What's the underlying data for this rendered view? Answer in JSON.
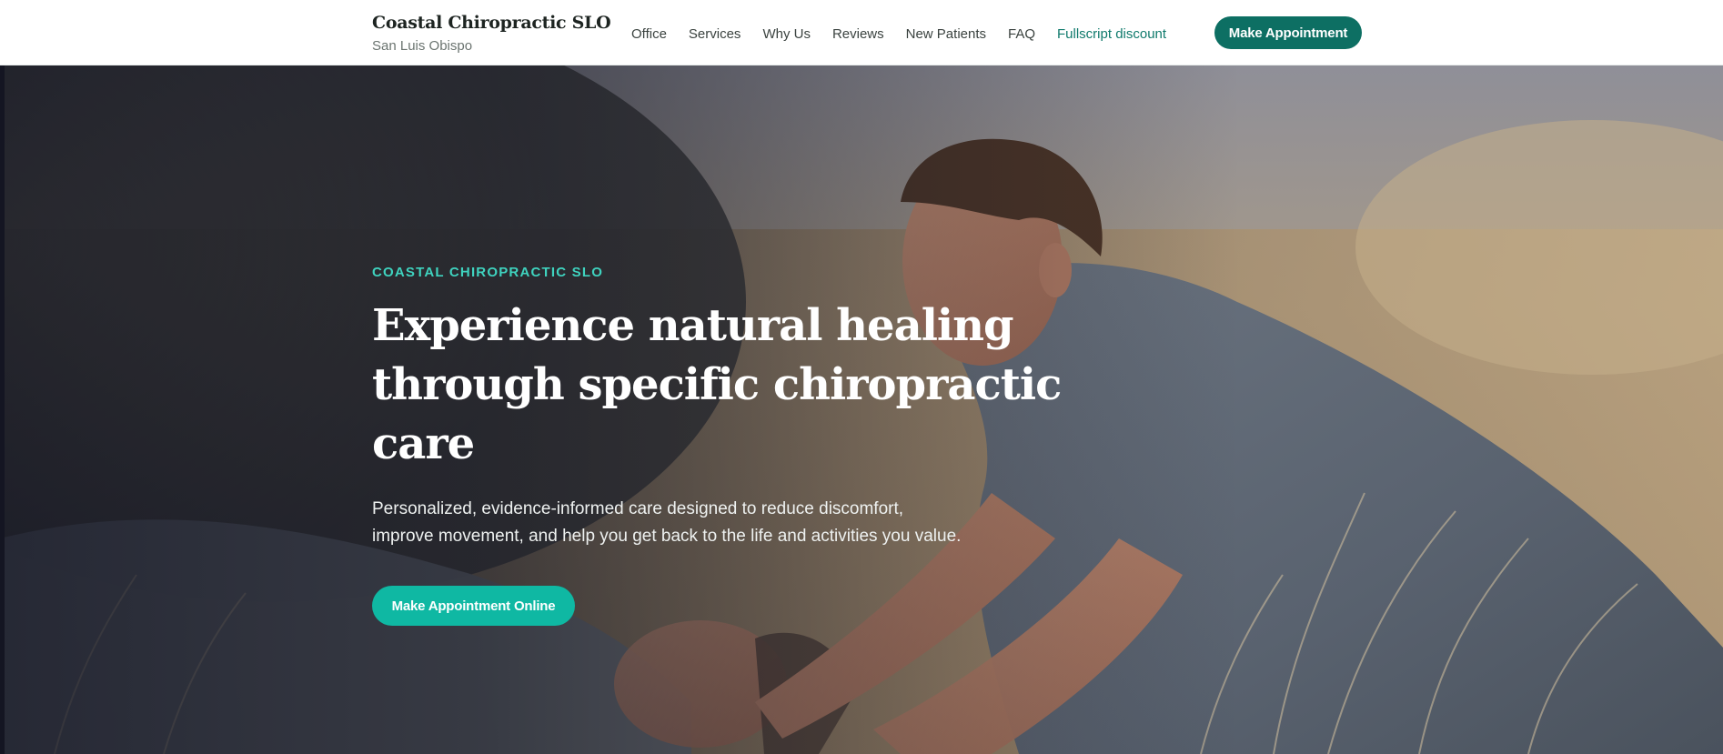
{
  "header": {
    "brand_name": "Coastal Chiropractic SLO",
    "brand_sub": "San Luis Obispo",
    "nav": [
      {
        "label": "Office"
      },
      {
        "label": "Services"
      },
      {
        "label": "Why Us"
      },
      {
        "label": "Reviews"
      },
      {
        "label": "New Patients"
      },
      {
        "label": "FAQ"
      },
      {
        "label": "Fullscript discount"
      }
    ],
    "cta_label": "Make Appointment"
  },
  "hero": {
    "eyebrow": "COASTAL CHIROPRACTIC SLO",
    "headline_lines": [
      "Experience natural healing",
      "through specific chiropractic",
      "care"
    ],
    "subhead_lines": [
      "Personalized, evidence-informed care designed to reduce discomfort,",
      "improve movement, and help you get back to the life and activities you value."
    ],
    "cta_label": "Make Appointment Online"
  },
  "colors": {
    "brand_dark_teal": "#0d6f63",
    "accent_teal": "#0fb8a3",
    "eyebrow_teal": "#3fd3bf",
    "nav_accent": "#0f7a6c"
  }
}
